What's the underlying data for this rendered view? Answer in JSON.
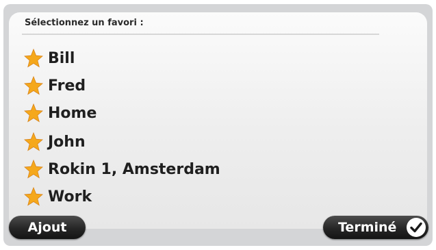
{
  "header": {
    "title": "Sélectionnez un favori :"
  },
  "favorites": [
    {
      "label": "Bill",
      "icon": "star-icon"
    },
    {
      "label": "Fred",
      "icon": "star-icon"
    },
    {
      "label": "Home",
      "icon": "star-icon"
    },
    {
      "label": "John",
      "icon": "star-icon"
    },
    {
      "label": "Rokin 1, Amsterdam",
      "icon": "star-icon"
    },
    {
      "label": "Work",
      "icon": "star-icon"
    }
  ],
  "footer": {
    "add_label": "Ajout",
    "done_label": "Terminé",
    "done_icon": "checkmark-icon"
  },
  "colors": {
    "star": "#f5a81c",
    "button": "#262626"
  }
}
